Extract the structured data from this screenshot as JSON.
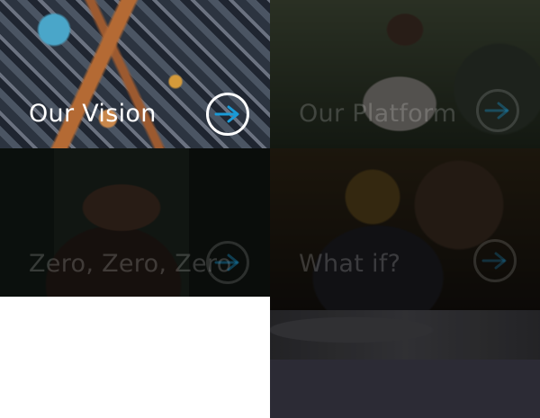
{
  "tiles": [
    {
      "label": "Our Vision",
      "active": true
    },
    {
      "label": "Our Platform",
      "active": false
    },
    {
      "label": "Zero, Zero, Zero",
      "active": false
    },
    {
      "label": "What if?",
      "active": false
    }
  ],
  "icons": {
    "arrow": "arrow-right-icon"
  },
  "colors": {
    "arrow_accent": "#1a9ad6",
    "bottom_strip": "#2c2b35"
  }
}
